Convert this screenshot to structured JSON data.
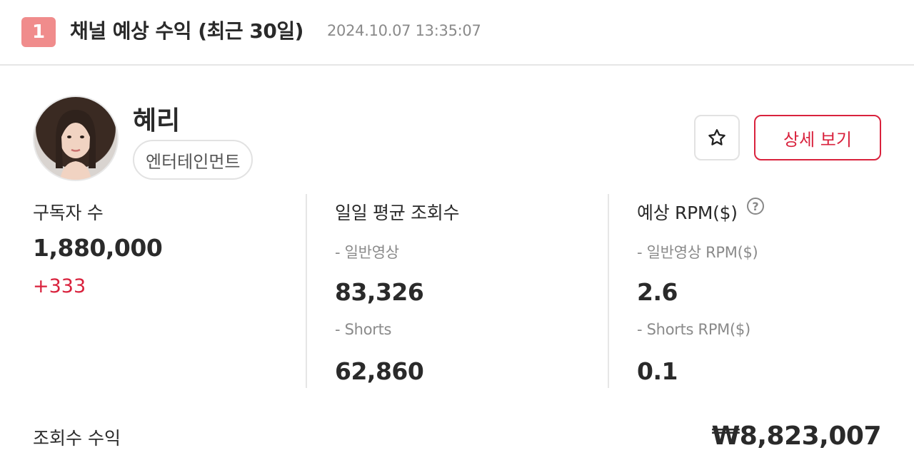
{
  "header": {
    "rank": "1",
    "title": "채널 예상 수익 (최근 30일)",
    "timestamp": "2024.10.07 13:35:07"
  },
  "channel": {
    "name": "혜리",
    "category": "엔터테인먼트",
    "favorite_icon": "star-outline-icon",
    "detail_button_label": "상세 보기"
  },
  "stats": {
    "subscribers": {
      "label": "구독자 수",
      "value": "1,880,000",
      "delta": "+333"
    },
    "daily_views": {
      "label": "일일 평균 조회수",
      "regular_label": "- 일반영상",
      "regular_value": "83,326",
      "shorts_label": "- Shorts",
      "shorts_value": "62,860"
    },
    "rpm": {
      "label": "예상 RPM($)",
      "help_icon": "question-circle-icon",
      "help_glyph": "?",
      "regular_label": "- 일반영상 RPM($)",
      "regular_value": "2.6",
      "shorts_label": "- Shorts RPM($)",
      "shorts_value": "0.1"
    }
  },
  "revenue": {
    "label": "조회수 수익",
    "value": "₩8,823,007"
  },
  "colors": {
    "accent": "#d9223d",
    "badge": "#f08c8c"
  }
}
